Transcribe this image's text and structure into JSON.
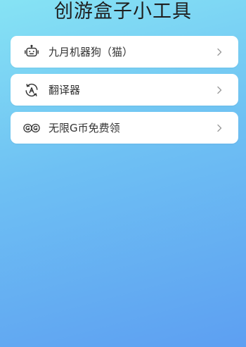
{
  "app": {
    "title": "创游盒子小工具"
  },
  "menu": {
    "items": [
      {
        "label": "九月机器狗（猫）",
        "icon": "robot-icon"
      },
      {
        "label": "翻译器",
        "icon": "translate-icon"
      },
      {
        "label": "无限G币免费领",
        "icon": "coins-icon"
      }
    ]
  },
  "colors": {
    "bg_top": "#86e3f4",
    "bg_bottom": "#5d9ff2",
    "card": "#ffffff",
    "text": "#333333",
    "chevron": "#9a9a9a"
  }
}
